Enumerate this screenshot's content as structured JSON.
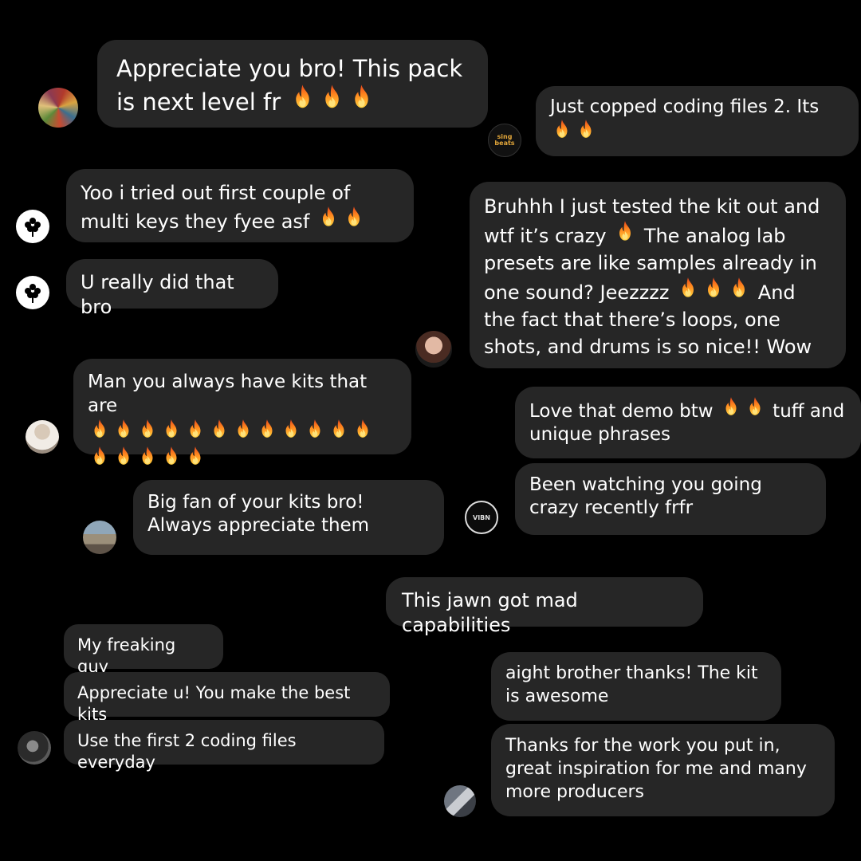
{
  "messages": [
    {
      "id": "m1",
      "text": "Appreciate you bro! This pack is next level fr",
      "fires": 3
    },
    {
      "id": "m2",
      "text": "Just copped coding files 2. Its",
      "fires": 2
    },
    {
      "id": "m3",
      "text": "Yoo i tried out first couple of multi keys they fyee asf",
      "fires": 2
    },
    {
      "id": "m4",
      "text": "U really did that bro"
    },
    {
      "id": "m5a",
      "text": "Bruhhh I just tested the kit out and wtf it’s crazy"
    },
    {
      "id": "m5b",
      "text": "The analog lab presets are like samples already in one sound? Jeezzzz"
    },
    {
      "id": "m5c",
      "text": "And the fact that there’s loops, one shots, and drums is so nice!! Wow"
    },
    {
      "id": "m6",
      "text": "Man you always have kits that are",
      "fires": 17
    },
    {
      "id": "m7a",
      "text": "Love that demo btw"
    },
    {
      "id": "m7b",
      "text": "tuff and unique phrases"
    },
    {
      "id": "m8",
      "text": "Been watching you going crazy recently frfr"
    },
    {
      "id": "m9",
      "text": "Big fan of your kits bro! Always appreciate them"
    },
    {
      "id": "m10",
      "text": "This jawn got mad capabilities"
    },
    {
      "id": "m11",
      "text": "My freaking guy"
    },
    {
      "id": "m12",
      "text": "Appreciate u! You make the best kits"
    },
    {
      "id": "m13",
      "text": "Use the first 2 coding files everyday"
    },
    {
      "id": "m14",
      "text": "aight brother thanks! The kit is awesome"
    },
    {
      "id": "m15",
      "text": "Thanks for the work you put in, great inspiration for me and many more producers"
    }
  ],
  "avatars": {
    "logo_text": "sing beats",
    "badge_text": "VIBN"
  },
  "colors": {
    "background": "#000000",
    "bubble": "#262626",
    "text": "#ffffff",
    "fire": "#ff7a1a"
  }
}
